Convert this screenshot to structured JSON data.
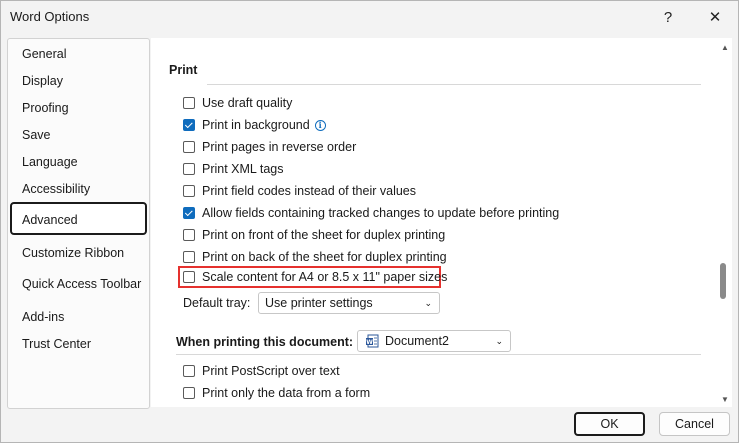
{
  "window": {
    "title": "Word Options",
    "help_glyph": "?",
    "close_glyph": "✕"
  },
  "sidebar": {
    "items": [
      {
        "label": "General"
      },
      {
        "label": "Display"
      },
      {
        "label": "Proofing"
      },
      {
        "label": "Save"
      },
      {
        "label": "Language"
      },
      {
        "label": "Accessibility"
      },
      {
        "label": "Advanced",
        "selected": true
      },
      {
        "label": "Customize Ribbon"
      },
      {
        "label": "Quick Access Toolbar"
      },
      {
        "label": "Add-ins"
      },
      {
        "label": "Trust Center"
      }
    ]
  },
  "print_section": {
    "title": "Print",
    "options": [
      {
        "label": "Use draft quality",
        "checked": false
      },
      {
        "label": "Print in background",
        "checked": true,
        "info_icon": "info-icon"
      },
      {
        "label": "Print pages in reverse order",
        "checked": false
      },
      {
        "label": "Print XML tags",
        "checked": false
      },
      {
        "label": "Print field codes instead of their values",
        "checked": false
      },
      {
        "label": "Allow fields containing tracked changes to update before printing",
        "checked": true
      },
      {
        "label": "Print on front of the sheet for duplex printing",
        "checked": false
      },
      {
        "label": "Print on back of the sheet for duplex printing",
        "checked": false
      },
      {
        "label": "Scale content for A4 or 8.5 x 11\" paper sizes",
        "checked": false,
        "highlighted": true
      }
    ],
    "default_tray": {
      "label": "Default tray:",
      "value": "Use printer settings"
    }
  },
  "when_printing": {
    "title": "When printing this document:",
    "document": "Document2",
    "options": [
      {
        "label": "Print PostScript over text",
        "checked": false
      },
      {
        "label": "Print only the data from a form",
        "checked": false
      }
    ]
  },
  "buttons": {
    "ok": "OK",
    "cancel": "Cancel"
  },
  "colors": {
    "accent": "#0f6cbd",
    "highlight": "#e5312e"
  }
}
